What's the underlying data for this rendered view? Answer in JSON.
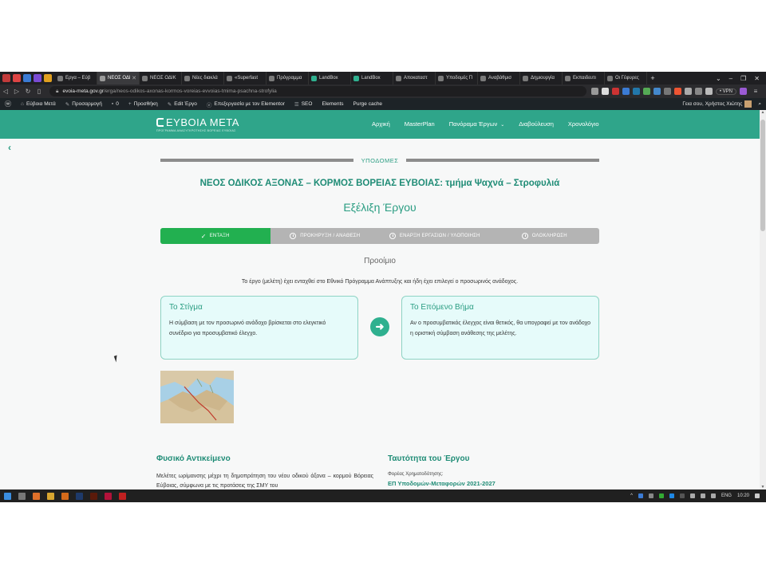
{
  "browser": {
    "tabs": [
      {
        "label": "Εργα – Εύβ",
        "active": false
      },
      {
        "label": "ΝΕΟΣ ΟΔΙ",
        "active": true
      },
      {
        "label": "ΝΕΟΣ ΟΔΙΚ",
        "active": false
      },
      {
        "label": "Νέες διακλά",
        "active": false
      },
      {
        "label": "«Superfast",
        "active": false
      },
      {
        "label": "Πρόγραμμα",
        "active": false
      },
      {
        "label": "LandBox",
        "active": false
      },
      {
        "label": "LandBox",
        "active": false
      },
      {
        "label": "Αποκαταστ",
        "active": false
      },
      {
        "label": "Υποδομές Π",
        "active": false
      },
      {
        "label": "Αναβάθμισ",
        "active": false
      },
      {
        "label": "Δημιουργία",
        "active": false
      },
      {
        "label": "Εκπαιδευτι",
        "active": false
      },
      {
        "label": "Οι Γέφυρες",
        "active": false
      }
    ],
    "url_domain": "evoia-meta.gov.gr",
    "url_path": "/erga/neos-odikos-axonas-kormos-voreias-evvoias-tmima-psachna-strofylia",
    "vpn_label": "• VPN"
  },
  "wpbar": {
    "items": [
      {
        "name": "site",
        "label": "Εύβοια Μετά"
      },
      {
        "name": "customize",
        "label": "Προσαρμογή"
      },
      {
        "name": "comments",
        "label": "0"
      },
      {
        "name": "new",
        "label": "Προσθήκη"
      },
      {
        "name": "edit",
        "label": "Edit Έργο"
      },
      {
        "name": "elementor",
        "label": "Επεξεργασία με τον Elementor"
      },
      {
        "name": "seo",
        "label": "SEO"
      },
      {
        "name": "elements",
        "label": "Elements"
      },
      {
        "name": "purge",
        "label": "Purge cache"
      }
    ],
    "greeting": "Γεια σου, Χρήστος Χιώτης"
  },
  "site": {
    "logo_title": "ΕΥΒΟΙΑ ΜΕΤΑ",
    "logo_subtitle": "ΠΡΟΓΡΑΜΜΑ ΑΝΑΣΥΓΚΡΟΤΗΣΗΣ ΒΟΡΕΙΑΣ ΕΥΒΟΙΑΣ",
    "nav": [
      "Αρχική",
      "MasterPlan",
      "Πανόραμα Έργων",
      "Διαβούλευση",
      "Χρονολόγιο"
    ]
  },
  "project": {
    "category": "ΥΠΟΔΟΜΕΣ",
    "title": "ΝΕΟΣ ΟΔΙΚΟΣ ΑΞΟΝΑΣ – ΚΟΡΜΟΣ ΒΟΡΕΙΑΣ ΕΥΒΟΙΑΣ: τμήμα Ψαχνά – Στροφυλιά",
    "evolution_title": "Εξέλιξη Έργου",
    "steps": [
      {
        "label": "ΕΝΤΑΞΗ",
        "active": true
      },
      {
        "label": "ΠΡΟΚΗΡΥΞΗ / ΑΝΑΘΕΣΗ",
        "active": false
      },
      {
        "label": "ΕΝΑΡΞΗ ΕΡΓΑΣΙΩΝ / ΥΛΟΠΟΙΗΣΗ",
        "active": false
      },
      {
        "label": "ΟΛΟΚΛΗΡΩΣΗ",
        "active": false
      }
    ],
    "subsection": "Προοίμιο",
    "intro": "Το έργο (μελέτη) έχει ενταχθεί στο Εθνικό Πρόγραμμα Ανάπτυξης και ήδη έχει επιλεγεί ο προσωρινός ανάδοχος.",
    "now_card": {
      "title": "Το Στίγμα",
      "text": "Η σύμβαση με τον προσωρινό ανάδοχο βρίσκεται στο ελεγκτικό συνέδριο για προσυμβατικό έλεγχο."
    },
    "next_card": {
      "title": "Το Επόμενο Βήμα",
      "text": "Αν ο προσυμβατικός έλεγχος είναι θετικός, θα υπογραφεί με τον ανάδοχο η οριστική σύμβαση ανάθεσης της μελέτης."
    },
    "physical_title": "Φυσικό Αντικείμενο",
    "physical_text": "Μελέτες ωρίμανσης μέχρι τη δημοπράτηση του νέου οδικού άξονα – κορμού Βόρειας Εύβοιας, σύμφωνα με τις προτάσεις της ΣΜΥ του",
    "identity_title": "Ταυτότητα του Έργου",
    "funding_label": "Φορέας Χρηματοδότησης:",
    "funding_value": "ΕΠ Υποδομών-Μεταφορών 2021-2027"
  },
  "taskbar": {
    "lang": "ENG",
    "time": "10:20"
  },
  "colors": {
    "brand": "#2fa58a",
    "active_step": "#22b050",
    "card_bg": "#e6fbfa"
  }
}
